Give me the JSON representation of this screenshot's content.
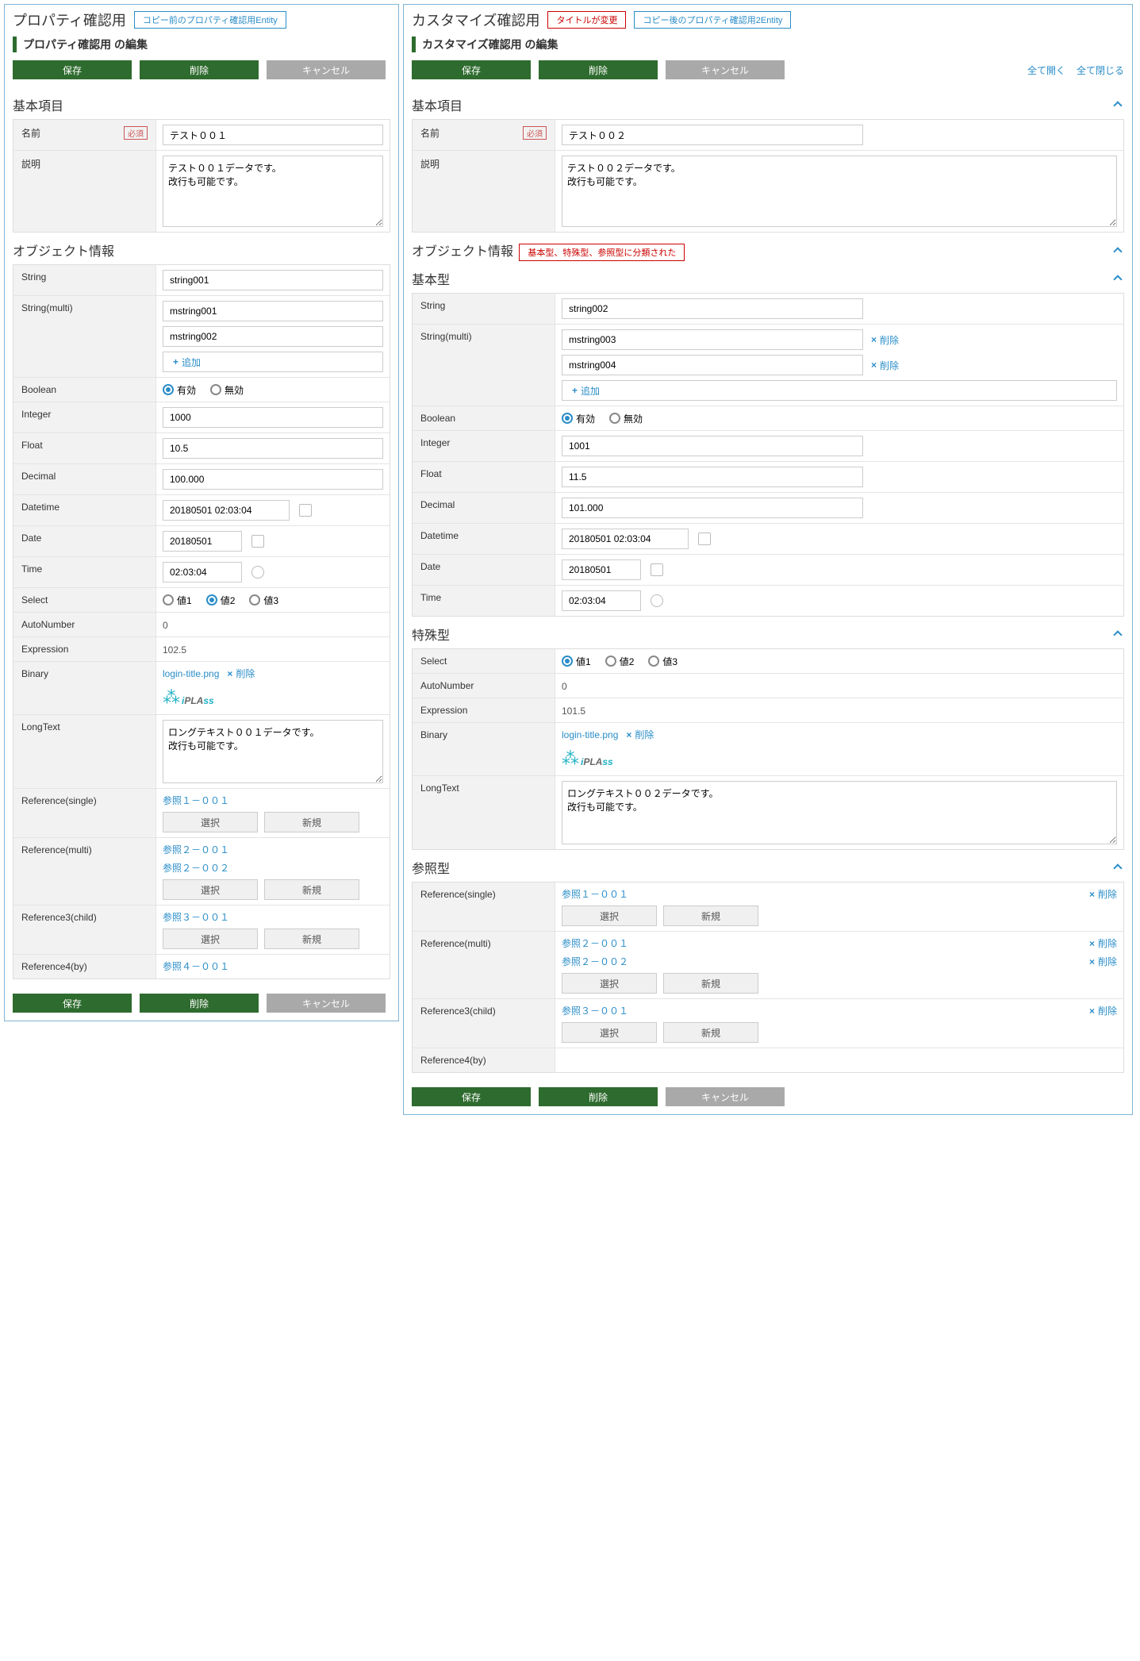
{
  "left": {
    "header_title": "プロパティ確認用",
    "header_callout": "コピー前のプロパティ確認用Entity",
    "subtitle": "プロパティ確認用 の編集",
    "btn_save": "保存",
    "btn_delete": "削除",
    "btn_cancel": "キャンセル",
    "sect_basic": "基本項目",
    "sect_obj": "オブジェクト情報",
    "lab_name": "名前",
    "req": "必須",
    "name_val": "テスト００１",
    "lab_desc": "説明",
    "desc_val": "テスト００１データです。\n改行も可能です。",
    "lab_string": "String",
    "string_val": "string001",
    "lab_mstring": "String(multi)",
    "mstring": [
      "mstring001",
      "mstring002"
    ],
    "add": "追加",
    "lab_bool": "Boolean",
    "bool_on": "有効",
    "bool_off": "無効",
    "lab_int": "Integer",
    "int_val": "1000",
    "lab_float": "Float",
    "float_val": "10.5",
    "lab_dec": "Decimal",
    "dec_val": "100.000",
    "lab_dt": "Datetime",
    "dt_val": "20180501 02:03:04",
    "lab_date": "Date",
    "date_val": "20180501",
    "lab_time": "Time",
    "time_val": "02:03:04",
    "lab_sel": "Select",
    "sel_opts": [
      "値1",
      "値2",
      "値3"
    ],
    "lab_auto": "AutoNumber",
    "auto_val": "0",
    "lab_expr": "Expression",
    "expr_val": "102.5",
    "lab_bin": "Binary",
    "bin_file": "login-title.png",
    "del": "削除",
    "lab_long": "LongText",
    "long_val": "ロングテキスト００１データです。\n改行も可能です。",
    "lab_ref1": "Reference(single)",
    "ref1": "参照１－００１",
    "select": "選択",
    "new": "新規",
    "lab_ref2": "Reference(multi)",
    "ref2": [
      "参照２－００１",
      "参照２－００２"
    ],
    "lab_ref3": "Reference3(child)",
    "ref3": "参照３－００１",
    "lab_ref4": "Reference4(by)",
    "ref4": "参照４－００１"
  },
  "right": {
    "header_title": "カスタマイズ確認用",
    "callout_red": "タイトルが変更",
    "callout_blue": "コピー後のプロパティ確認用2Entity",
    "subtitle": "カスタマイズ確認用 の編集",
    "btn_save": "保存",
    "btn_delete": "削除",
    "btn_cancel": "キャンセル",
    "link_open": "全て開く",
    "link_close": "全て閉じる",
    "sect_basic": "基本項目",
    "lab_name": "名前",
    "req": "必須",
    "name_val": "テスト００２",
    "lab_desc": "説明",
    "desc_val": "テスト００２データです。\n改行も可能です。",
    "sect_obj": "オブジェクト情報",
    "obj_callout": "基本型、特殊型、参照型に分類された",
    "sect_basic_type": "基本型",
    "lab_string": "String",
    "string_val": "string002",
    "lab_mstring": "String(multi)",
    "mstring": [
      "mstring003",
      "mstring004"
    ],
    "add": "追加",
    "del": "削除",
    "lab_bool": "Boolean",
    "bool_on": "有効",
    "bool_off": "無効",
    "lab_int": "Integer",
    "int_val": "1001",
    "lab_float": "Float",
    "float_val": "11.5",
    "lab_dec": "Decimal",
    "dec_val": "101.000",
    "lab_dt": "Datetime",
    "dt_val": "20180501 02:03:04",
    "lab_date": "Date",
    "date_val": "20180501",
    "lab_time": "Time",
    "time_val": "02:03:04",
    "sect_special": "特殊型",
    "lab_sel": "Select",
    "sel_opts": [
      "値1",
      "値2",
      "値3"
    ],
    "lab_auto": "AutoNumber",
    "auto_val": "0",
    "lab_expr": "Expression",
    "expr_val": "101.5",
    "lab_bin": "Binary",
    "bin_file": "login-title.png",
    "lab_long": "LongText",
    "long_val": "ロングテキスト００２データです。\n改行も可能です。",
    "sect_ref": "参照型",
    "lab_ref1": "Reference(single)",
    "ref1": "参照１－００１",
    "select": "選択",
    "new": "新規",
    "lab_ref2": "Reference(multi)",
    "ref2": [
      "参照２－００１",
      "参照２－００２"
    ],
    "lab_ref3": "Reference3(child)",
    "ref3": "参照３－００１",
    "lab_ref4": "Reference4(by)"
  }
}
